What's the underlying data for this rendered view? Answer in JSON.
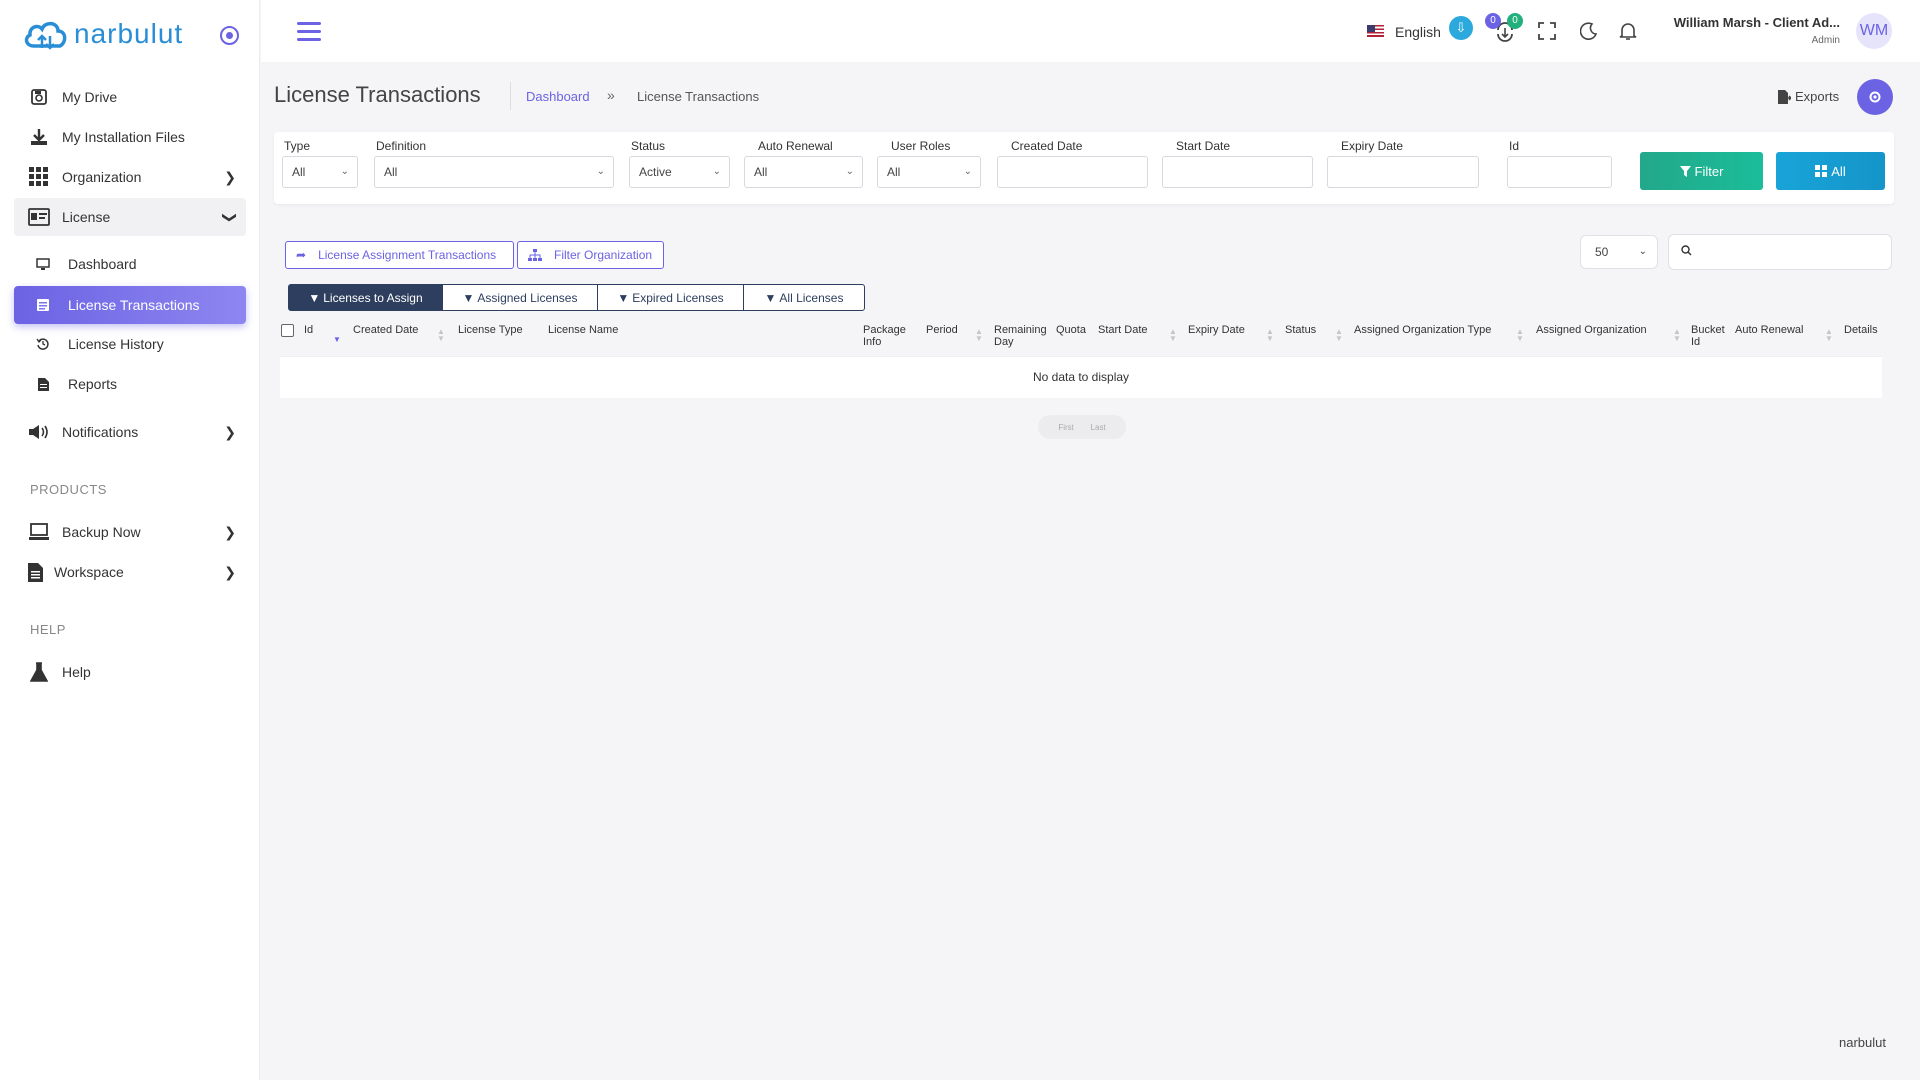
{
  "brand": {
    "logo_text": "narbulut"
  },
  "sidebar": {
    "items": [
      {
        "label": "My Drive"
      },
      {
        "label": "My Installation Files"
      },
      {
        "label": "Organization"
      },
      {
        "label": "License"
      }
    ],
    "license_sub": [
      {
        "label": "Dashboard"
      },
      {
        "label": "License Transactions"
      },
      {
        "label": "License History"
      },
      {
        "label": "Reports"
      }
    ],
    "notifications": {
      "label": "Notifications"
    },
    "products_title": "PRODUCTS",
    "products": [
      {
        "label": "Backup Now"
      },
      {
        "label": "Workspace"
      }
    ],
    "help_title": "HELP",
    "help": {
      "label": "Help"
    }
  },
  "topbar": {
    "language": "English",
    "badge_a": "0",
    "badge_b": "0",
    "user_name": "William Marsh - Client Ad...",
    "user_role": "Admin",
    "avatar_initials": "WM"
  },
  "page": {
    "title": "License Transactions",
    "breadcrumb_root": "Dashboard",
    "breadcrumb_sep": "»",
    "breadcrumb_current": "License Transactions",
    "exports_label": "Exports"
  },
  "filters": {
    "type": {
      "label": "Type",
      "value": "All"
    },
    "definition": {
      "label": "Definition",
      "value": "All"
    },
    "status": {
      "label": "Status",
      "value": "Active"
    },
    "auto_renewal": {
      "label": "Auto Renewal",
      "value": "All"
    },
    "user_roles": {
      "label": "User Roles",
      "value": "All"
    },
    "created_date": {
      "label": "Created Date"
    },
    "start_date": {
      "label": "Start Date"
    },
    "expiry_date": {
      "label": "Expiry Date"
    },
    "id": {
      "label": "Id"
    },
    "filter_button": "Filter",
    "all_button": "All"
  },
  "actions": {
    "assignment_transactions": "License Assignment Transactions",
    "filter_organization": "Filter Organization",
    "page_size": "50"
  },
  "tabs": [
    {
      "label": "Licenses to Assign"
    },
    {
      "label": "Assigned Licenses"
    },
    {
      "label": "Expired Licenses"
    },
    {
      "label": "All Licenses"
    }
  ],
  "table": {
    "columns": [
      "Id",
      "Created Date",
      "License Type",
      "License Name",
      "Package Info",
      "Period",
      "Remaining Day",
      "Quota",
      "Start Date",
      "Expiry Date",
      "Status",
      "Assigned Organization Type",
      "Assigned Organization",
      "Bucket Id",
      "Auto Renewal",
      "Details"
    ],
    "empty_message": "No data to display"
  },
  "pager": {
    "first": "First",
    "last": "Last"
  },
  "footer": {
    "brand": "narbulut"
  },
  "colors": {
    "accent": "#6b63e3",
    "filter_button": "#1fb08f",
    "all_button": "#18a0d4",
    "tab_dark": "#2d3e5e"
  }
}
